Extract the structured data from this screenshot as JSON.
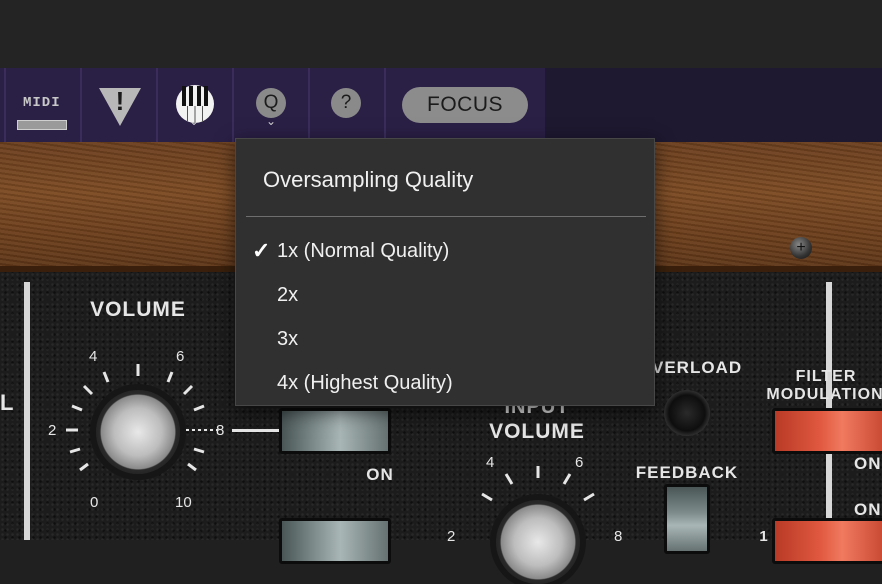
{
  "toolbar": {
    "midi_label": "MIDI",
    "quality_label": "Q",
    "help_label": "?",
    "focus_label": "FOCUS",
    "warning_label": "!",
    "caret": "⌄"
  },
  "panel": {
    "volume_label": "VOLUME",
    "volume_ticks": [
      "0",
      "2",
      "4",
      "6",
      "8",
      "10"
    ],
    "left_label_fragment": "L",
    "on_label": "ON",
    "input_volume_label_1": "INPUT",
    "input_volume_label_2": "VOLUME",
    "input_ticks": [
      "4",
      "6",
      "2",
      "8"
    ],
    "overload_label": "VERLOAD",
    "feedback_label": "FEEDBACK",
    "filter_modulation_label_1": "FILTER",
    "filter_modulation_label_2": "MODULATION",
    "right_on_label": "ON",
    "right_on_label_2": "ON",
    "right_one_label": "1",
    "screw_glyph": "+"
  },
  "dropdown": {
    "title": "Oversampling Quality",
    "items": [
      {
        "label": "1x (Normal Quality)",
        "checked": true,
        "check": "✓"
      },
      {
        "label": "2x",
        "checked": false
      },
      {
        "label": "3x",
        "checked": false
      },
      {
        "label": "4x (Highest Quality)",
        "checked": false
      }
    ]
  },
  "colors": {
    "toolbar": "#2a1f45",
    "menu_bg": "#303030",
    "switch_red": "#e0583f",
    "switch_grey": "#7d8b8b"
  }
}
